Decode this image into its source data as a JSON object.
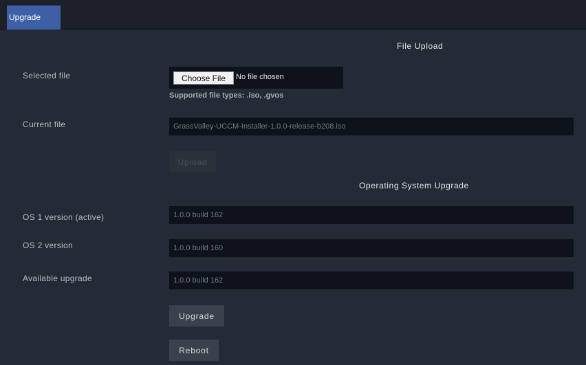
{
  "tabs": [
    {
      "label": "Upgrade",
      "active": true
    }
  ],
  "file_upload": {
    "title": "File Upload",
    "selected_file_label": "Selected file",
    "choose_file_button": "Choose File",
    "no_file_text": "No file chosen",
    "supported_types": "Supported file types: .iso, .gvos",
    "current_file_label": "Current file",
    "current_file_value": "GrassValley-UCCM-Installer-1.0.0-release-b208.iso",
    "upload_button": "Upload"
  },
  "os_upgrade": {
    "title": "Operating System Upgrade",
    "os1_label": "OS 1 version (active)",
    "os1_value": "1.0.0 build 162",
    "os2_label": "OS 2 version",
    "os2_value": "1.0.0 build 160",
    "available_label": "Available upgrade",
    "available_value": "1.0.0 build 162",
    "upgrade_button": "Upgrade",
    "reboot_button": "Reboot"
  },
  "colors": {
    "background": "#252b36",
    "tab_active": "#3c5fa6",
    "field_background": "#0e121a",
    "button": "#3a414d"
  }
}
